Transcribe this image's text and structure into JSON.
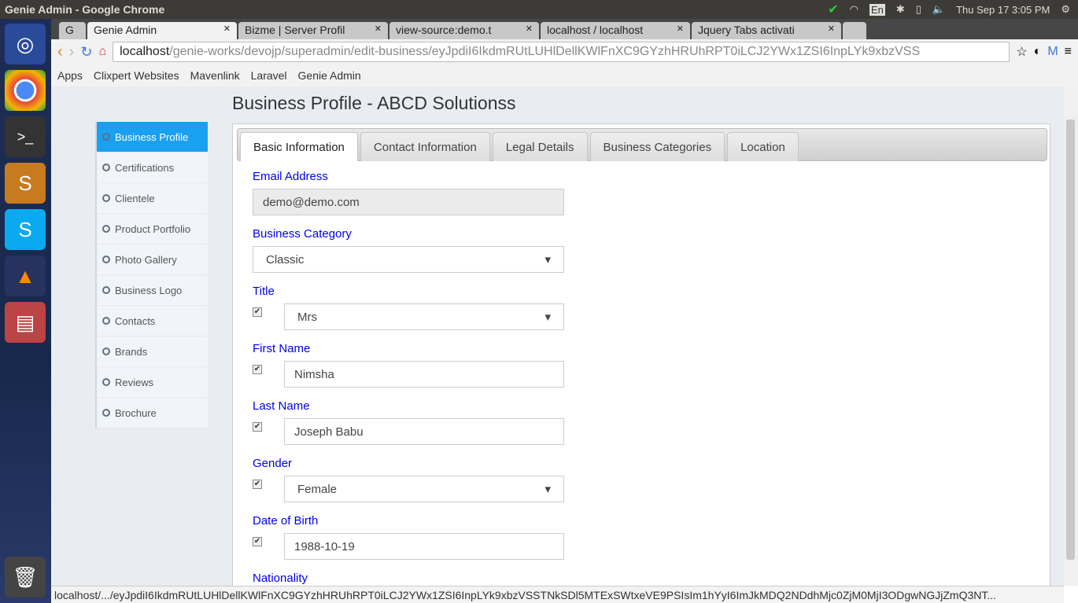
{
  "os": {
    "window_title": "Genie Admin - Google Chrome",
    "clock": "Thu Sep 17  3:05 PM",
    "keyboard": "En"
  },
  "browser": {
    "tabs": [
      {
        "label": "Genie Admin",
        "active": true
      },
      {
        "label": "Bizme | Server Profil"
      },
      {
        "label": "view-source:demo.t"
      },
      {
        "label": "localhost / localhost"
      },
      {
        "label": "Jquery Tabs activati"
      }
    ],
    "url_host": "localhost",
    "url_path": "/genie-works/devojp/superadmin/edit-business/eyJpdiI6IkdmRUtLUHlDellKWlFnXC9GYzhHRUhRPT0iLCJ2YWx1ZSI6InpLYk9xbzVSS",
    "bookmarks": [
      "Apps",
      "Clixpert Websites",
      "Mavenlink",
      "Laravel",
      "Genie Admin"
    ],
    "status_url": "localhost/.../eyJpdiI6IkdmRUtLUHlDellKWlFnXC9GYzhHRUhRPT0iLCJ2YWx1ZSI6InpLYk9xbzVSSTNkSDl5MTExSWtxeVE9PSIsIm1hYyI6ImJkMDQ2NDdhMjc0ZjM0MjI3ODgwNGJjZmQ3NT..."
  },
  "page": {
    "title": "Business Profile - ABCD Solutionss",
    "sidebar": [
      "Business Profile",
      "Certifications",
      "Clientele",
      "Product Portfolio",
      "Photo Gallery",
      "Business Logo",
      "Contacts",
      "Brands",
      "Reviews",
      "Brochure"
    ],
    "tabs": [
      "Basic Information",
      "Contact Information",
      "Legal Details",
      "Business Categories",
      "Location"
    ],
    "form": {
      "email_label": "Email Address",
      "email": "demo@demo.com",
      "category_label": "Business Category",
      "category": "Classic",
      "title_label": "Title",
      "title": "Mrs",
      "first_label": "First Name",
      "first": "Nimsha",
      "last_label": "Last Name",
      "last": "Joseph Babu",
      "gender_label": "Gender",
      "gender": "Female",
      "dob_label": "Date of Birth",
      "dob": "1988-10-19",
      "nationality_label": "Nationality"
    }
  }
}
